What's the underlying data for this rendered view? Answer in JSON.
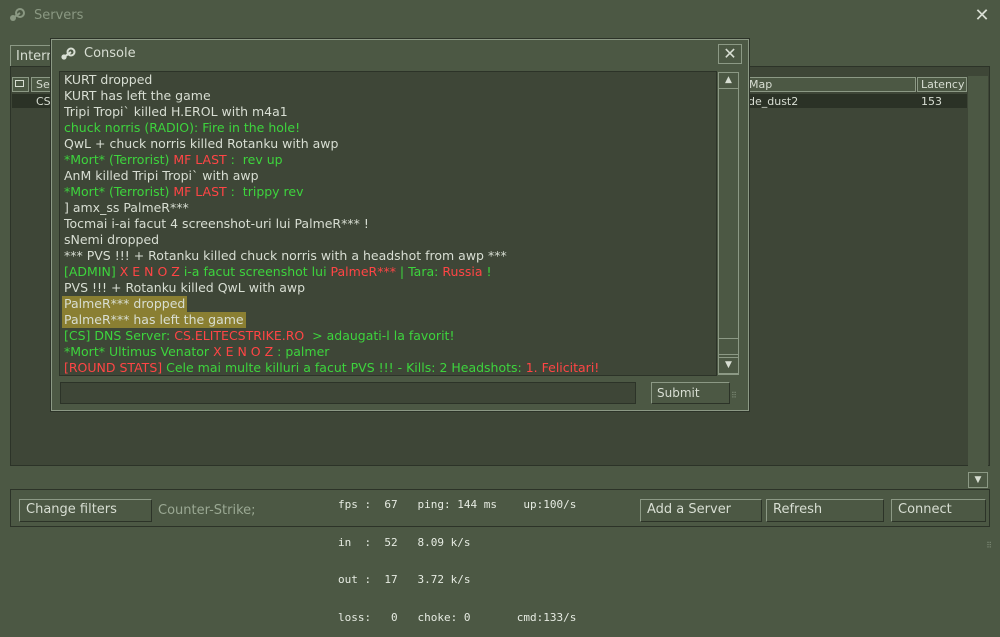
{
  "servers_window": {
    "title": "Servers",
    "close_icon": "close-icon",
    "tab_internet": "Internet",
    "columns": {
      "servers": "Servers",
      "map": "Map",
      "latency": "Latency"
    },
    "selected_row": {
      "name": "CS",
      "map": "de_dust2",
      "latency": "153"
    },
    "buttons": {
      "change_filters": "Change filters",
      "add_server": "Add a Server",
      "refresh": "Refresh",
      "connect": "Connect"
    },
    "filter_text": "Counter-Strike;"
  },
  "netgraph": {
    "line1": "fps :  67   ping: 144 ms    up:100/s",
    "line2": "in  :  52   8.09 k/s",
    "line3": "out :  17   3.72 k/s",
    "line4": "loss:   0   choke: 0       cmd:133/s"
  },
  "console": {
    "title": "Console",
    "submit_label": "Submit",
    "input_value": "",
    "lines": [
      [
        {
          "t": "KURT dropped",
          "c": ""
        }
      ],
      [
        {
          "t": "KURT has left the game",
          "c": ""
        }
      ],
      [
        {
          "t": "Tripi Tropi` killed H.EROL with m4a1",
          "c": ""
        }
      ],
      [
        {
          "t": "chuck norris (RADIO): Fire in the hole!",
          "c": "g"
        }
      ],
      [
        {
          "t": "QwL + chuck norris killed Rotanku with awp",
          "c": ""
        }
      ],
      [
        {
          "t": "*Mort* (Terrorist) ",
          "c": "g"
        },
        {
          "t": "MF LAST",
          "c": "r"
        },
        {
          "t": " :  rev up",
          "c": "g"
        }
      ],
      [
        {
          "t": "AnM killed Tripi Tropi` with awp",
          "c": ""
        }
      ],
      [
        {
          "t": "*Mort* (Terrorist) ",
          "c": "g"
        },
        {
          "t": "MF LAST",
          "c": "r"
        },
        {
          "t": " :  trippy rev",
          "c": "g"
        }
      ],
      [
        {
          "t": "] amx_ss PalmeR***",
          "c": ""
        }
      ],
      [
        {
          "t": "Tocmai i-ai facut 4 screenshot-uri lui PalmeR*** !",
          "c": ""
        }
      ],
      [
        {
          "t": "sNemi dropped",
          "c": ""
        }
      ],
      [
        {
          "t": "*** PVS !!! + Rotanku killed chuck norris with a headshot from awp ***",
          "c": ""
        }
      ],
      [
        {
          "t": "[ADMIN] ",
          "c": "g"
        },
        {
          "t": "X E N O Z ",
          "c": "r"
        },
        {
          "t": "i-a facut screenshot lui ",
          "c": "g"
        },
        {
          "t": "PalmeR***",
          "c": "r"
        },
        {
          "t": " | Tara: ",
          "c": "g"
        },
        {
          "t": "Russia",
          "c": "r"
        },
        {
          "t": " !",
          "c": "g"
        }
      ],
      [
        {
          "t": "PVS !!! + Rotanku killed QwL with awp",
          "c": ""
        }
      ],
      [
        {
          "t": "PalmeR*** dropped",
          "c": "hl"
        }
      ],
      [
        {
          "t": "PalmeR*** has left the game",
          "c": "hl"
        }
      ],
      [
        {
          "t": "[CS] DNS Server: ",
          "c": "g"
        },
        {
          "t": "CS.ELITECSTRIKE.RO",
          "c": "r"
        },
        {
          "t": "  > adaugati-l la favorit!",
          "c": "g"
        }
      ],
      [
        {
          "t": "*Mort* ",
          "c": "g"
        },
        {
          "t": "Ultimus Venator ",
          "c": "g"
        },
        {
          "t": "X E N O Z",
          "c": "r"
        },
        {
          "t": " : palmer",
          "c": "g"
        }
      ],
      [
        {
          "t": "[ROUND STATS] ",
          "c": "r"
        },
        {
          "t": "Cele mai multe killuri a facut ",
          "c": "g"
        },
        {
          "t": "PVS !!!",
          "c": "g"
        },
        {
          "t": " - Kills: ",
          "c": "g"
        },
        {
          "t": "2",
          "c": "g"
        },
        {
          "t": " Headshots: ",
          "c": "g"
        },
        {
          "t": "1. Felicitari!",
          "c": "r"
        }
      ]
    ]
  },
  "colors": {
    "background": "#4c5844",
    "panel": "#3e4637",
    "text": "#d8ded3",
    "chat_green": "#3dd43d",
    "chat_red": "#ff4545",
    "highlight": "#8a7f32"
  }
}
